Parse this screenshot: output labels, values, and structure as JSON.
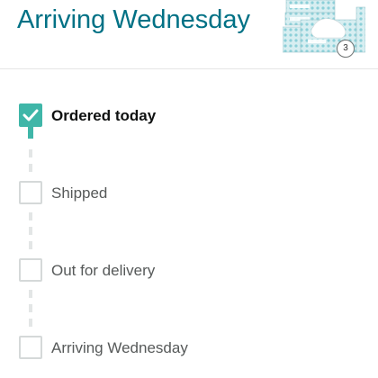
{
  "header": {
    "title": "Arriving Wednesday",
    "product_quantity": "3",
    "product_image_icon": "tissue-box-thumbnail-icon"
  },
  "timeline": {
    "steps": [
      {
        "label": "Ordered today",
        "completed": true
      },
      {
        "label": "Shipped",
        "completed": false
      },
      {
        "label": "Out for delivery",
        "completed": false
      },
      {
        "label": "Arriving Wednesday",
        "completed": false
      }
    ]
  },
  "colors": {
    "title": "#007185",
    "completed": "#3fb6a8",
    "pending_border": "#d5d9d9",
    "connector": "#e3e6e6"
  }
}
